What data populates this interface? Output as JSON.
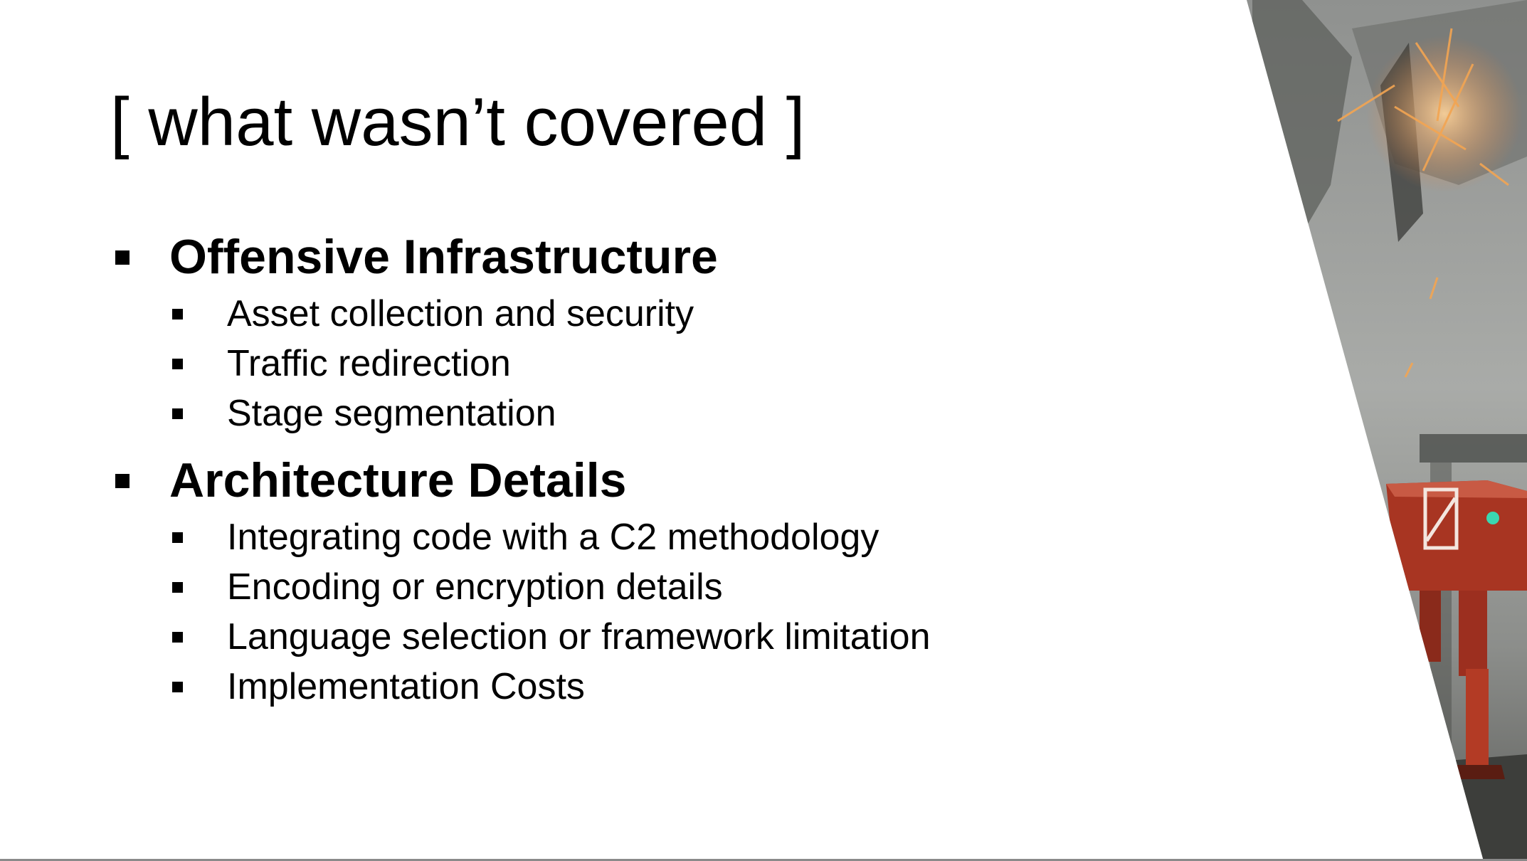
{
  "slide": {
    "title": "[ what wasn’t covered ]",
    "sections": [
      {
        "heading": "Offensive Infrastructure",
        "items": [
          "Asset collection and security",
          "Traffic redirection",
          "Stage segmentation"
        ]
      },
      {
        "heading": "Architecture Details",
        "items": [
          "Integrating code with a C2 methodology",
          "Encoding or encryption details",
          "Language selection or framework limitation",
          "Implementation Costs"
        ]
      }
    ]
  },
  "artwork": {
    "subject": "robot-with-sparks-illustration",
    "colors": {
      "sky": "#9a9d9b",
      "robot_body": "#b23a24",
      "sparks": "#f0a04a"
    }
  }
}
